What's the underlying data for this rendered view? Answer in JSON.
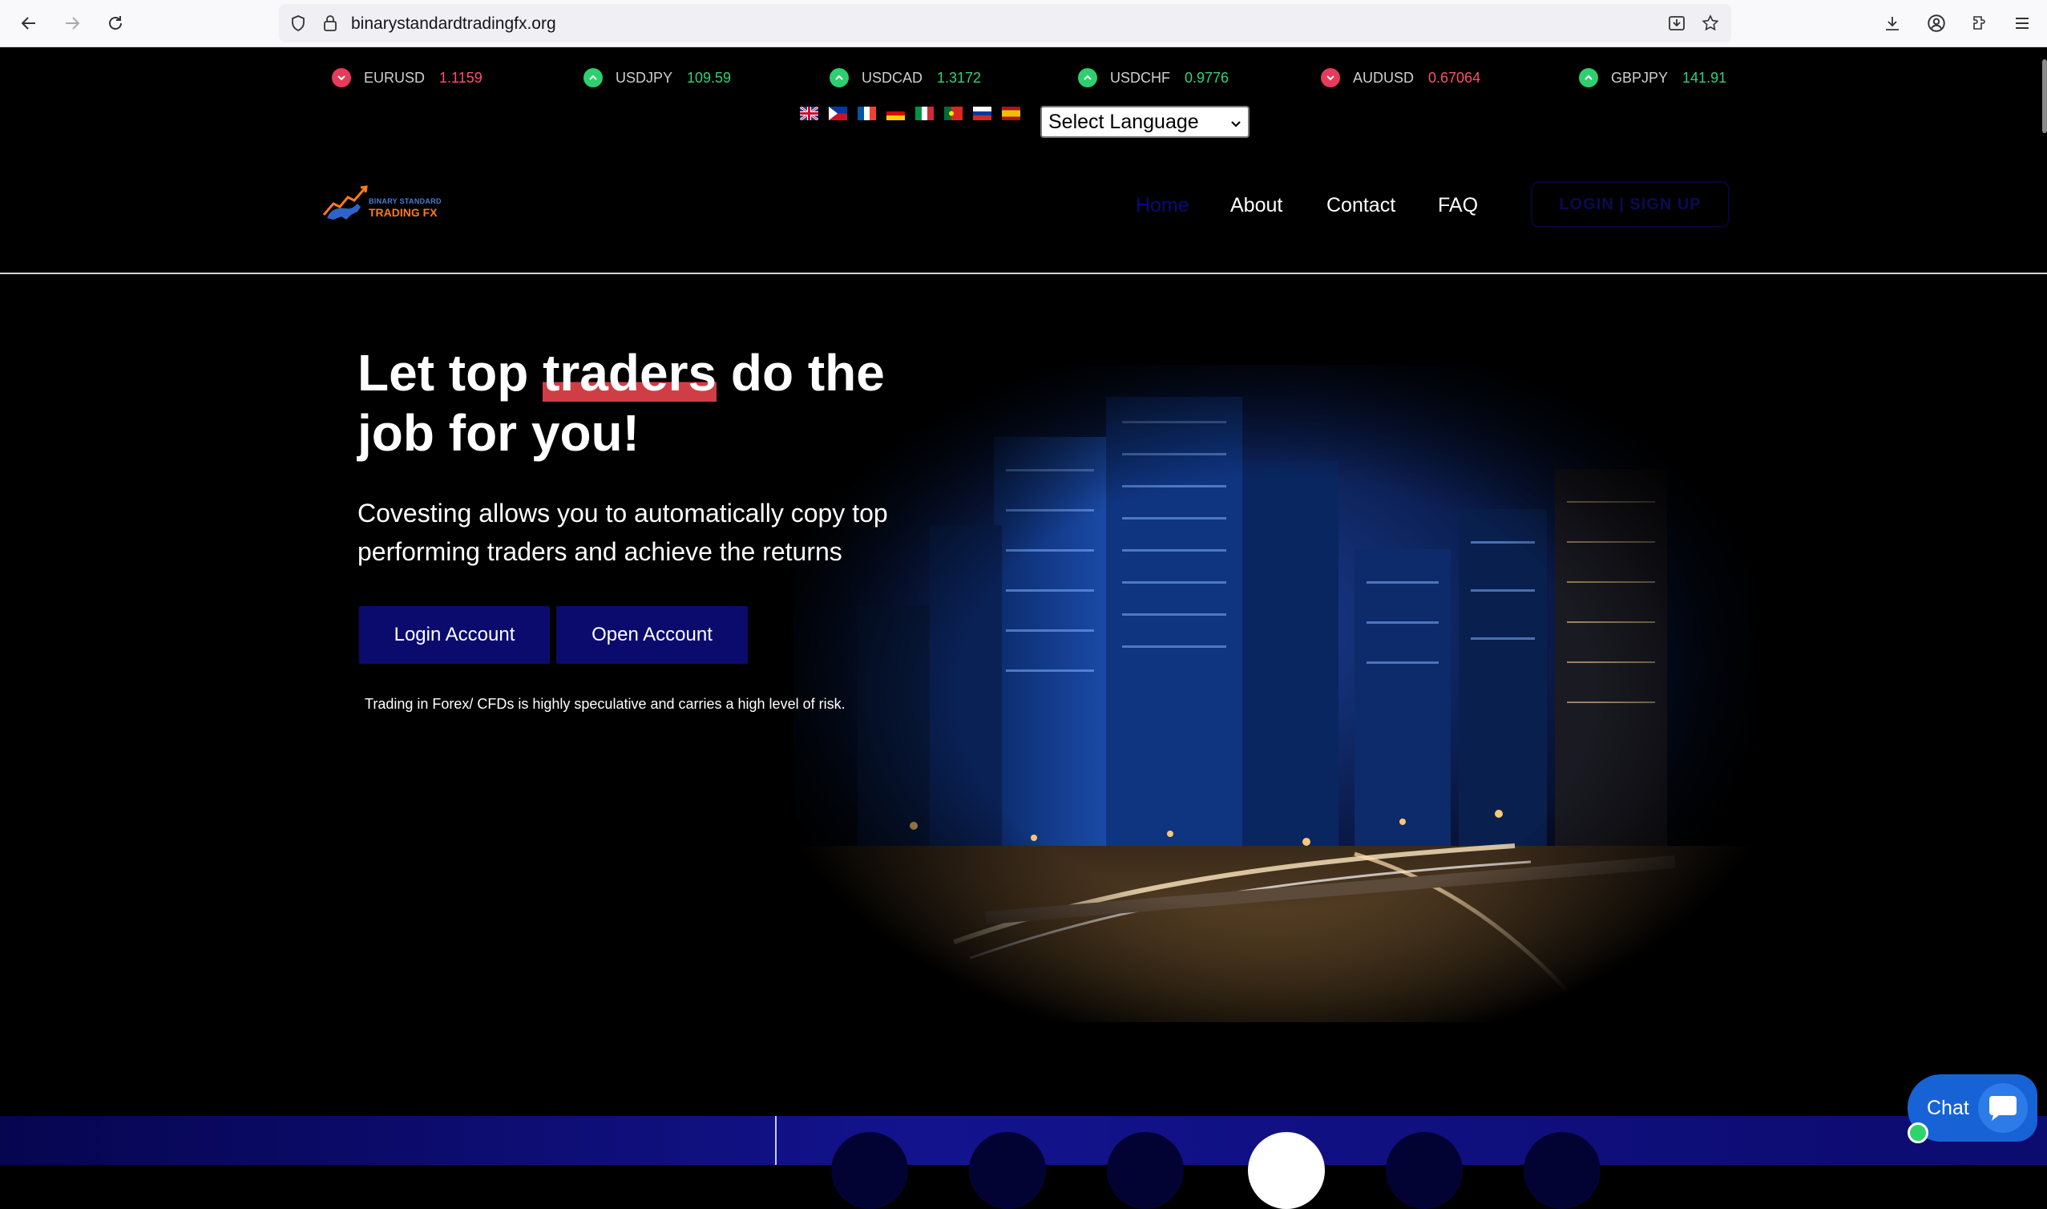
{
  "browser": {
    "url": "binarystandardtradingfx.org",
    "icons": [
      "back-icon",
      "forward-icon",
      "reload-icon",
      "shield-icon",
      "lock-icon",
      "install-icon",
      "star-icon",
      "download-icon",
      "account-icon",
      "extensions-icon",
      "menu-icon"
    ]
  },
  "ticker": [
    {
      "symbol": "EURUSD",
      "value": "1.1159",
      "direction": "down"
    },
    {
      "symbol": "USDJPY",
      "value": "109.59",
      "direction": "up"
    },
    {
      "symbol": "USDCAD",
      "value": "1.3172",
      "direction": "up"
    },
    {
      "symbol": "USDCHF",
      "value": "0.9776",
      "direction": "up"
    },
    {
      "symbol": "AUDUSD",
      "value": "0.67064",
      "direction": "down"
    },
    {
      "symbol": "GBPJPY",
      "value": "141.91",
      "direction": "up"
    }
  ],
  "language": {
    "select_label": "Select Language",
    "flags": [
      "english-flag",
      "filipino-flag",
      "french-flag",
      "german-flag",
      "italian-flag",
      "portuguese-flag",
      "russian-flag",
      "spanish-flag"
    ]
  },
  "logo": {
    "line1": "BINARY STANDARD",
    "line2": "TRADING FX"
  },
  "nav": {
    "home": "Home",
    "about": "About",
    "contact": "Contact",
    "faq": "FAQ",
    "auth": "LOGIN | SIGN UP"
  },
  "hero": {
    "title_part1": "Let top ",
    "title_highlight": "traders",
    "title_part2": " do the job for you!",
    "subtitle": "Covesting allows you to automatically copy top performing traders and achieve the returns",
    "login_button": "Login Account",
    "open_button": "Open Account",
    "risk_note": "Trading in Forex/ CFDs is highly speculative and carries a high level of risk."
  },
  "chat": {
    "label": "Chat"
  },
  "colors": {
    "accent": "#0b0b6e",
    "highlight": "#d13d44",
    "up": "#35d07a",
    "down": "#ff4f6e",
    "chat": "#1763d6"
  }
}
